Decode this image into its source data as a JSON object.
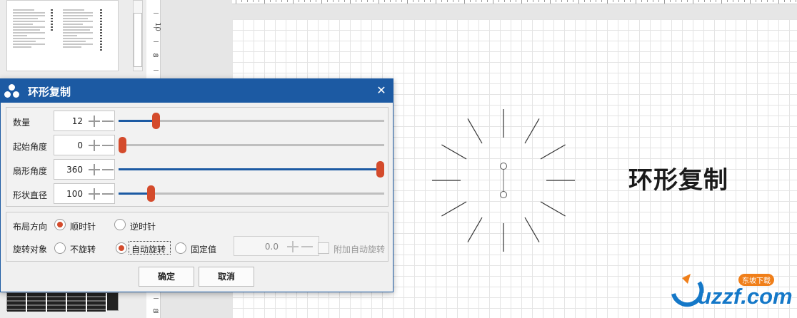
{
  "dialog": {
    "title": "环形复制",
    "close_symbol": "✕",
    "rows": [
      {
        "label": "数量",
        "value": "12",
        "slider_fraction": 0.13
      },
      {
        "label": "起始角度",
        "value": "0",
        "slider_fraction": 0.0
      },
      {
        "label": "扇形角度",
        "value": "360",
        "slider_fraction": 1.0
      },
      {
        "label": "形状直径",
        "value": "100",
        "slider_fraction": 0.11
      }
    ],
    "layout_direction": {
      "label": "布局方向",
      "options": [
        {
          "label": "顺时针",
          "checked": true
        },
        {
          "label": "逆时针",
          "checked": false
        }
      ]
    },
    "rotate_target": {
      "label": "旋转对象",
      "options": [
        {
          "label": "不旋转",
          "checked": false
        },
        {
          "label": "自动旋转",
          "checked": true
        },
        {
          "label": "固定值",
          "checked": false
        }
      ],
      "fixed_value": "0.0",
      "append_auto_rotate_label": "附加自动旋转",
      "append_auto_rotate_checked": false
    },
    "ok_label": "确定",
    "cancel_label": "取消"
  },
  "canvas": {
    "title": "环形复制",
    "radial_line_count": 12
  },
  "ruler": {
    "vertical_numbers": [
      "10",
      "8",
      "8"
    ]
  },
  "watermark": {
    "text": "uzzf.com",
    "badge": "东坡下载"
  },
  "colors": {
    "accent": "#1c5aa3",
    "handle": "#d44b2c",
    "watermark": "#1478c8"
  }
}
